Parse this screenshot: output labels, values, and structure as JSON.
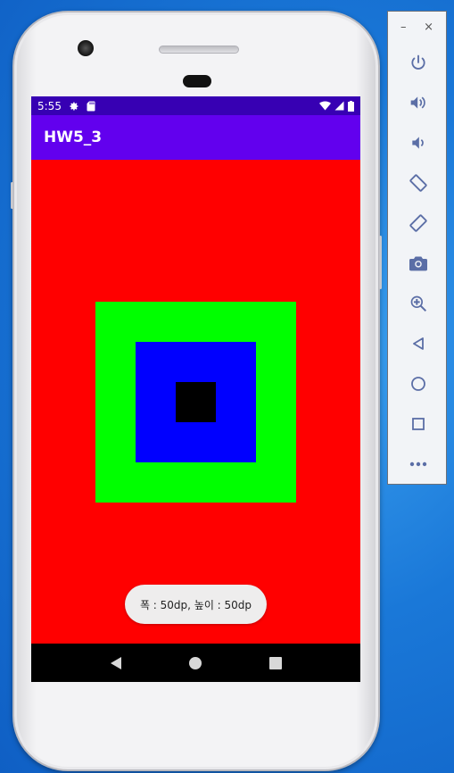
{
  "status_bar": {
    "time": "5:55"
  },
  "app_bar": {
    "title": "HW5_3"
  },
  "toast": {
    "text": "폭 : 50dp, 높이 : 50dp"
  },
  "colors": {
    "status_bar": "#3700b3",
    "app_bar": "#6200ee",
    "background": "#ff0000",
    "outer_square": "#00ff00",
    "middle_square": "#0000ff",
    "inner_square": "#000000",
    "nav_bar": "#000000"
  },
  "status_icons": [
    "settings-icon",
    "sd-card-icon",
    "wifi-icon",
    "signal-icon",
    "battery-icon"
  ],
  "nav_buttons": [
    "back-icon",
    "home-icon",
    "recents-icon"
  ],
  "emulator_panel": {
    "window_controls": {
      "minimize": "–",
      "close": "×"
    },
    "tools": [
      "power-icon",
      "volume-up-icon",
      "volume-down-icon",
      "rotate-left-icon",
      "rotate-right-icon",
      "camera-icon",
      "zoom-icon",
      "back-icon",
      "home-icon",
      "overview-icon",
      "more-icon"
    ]
  }
}
